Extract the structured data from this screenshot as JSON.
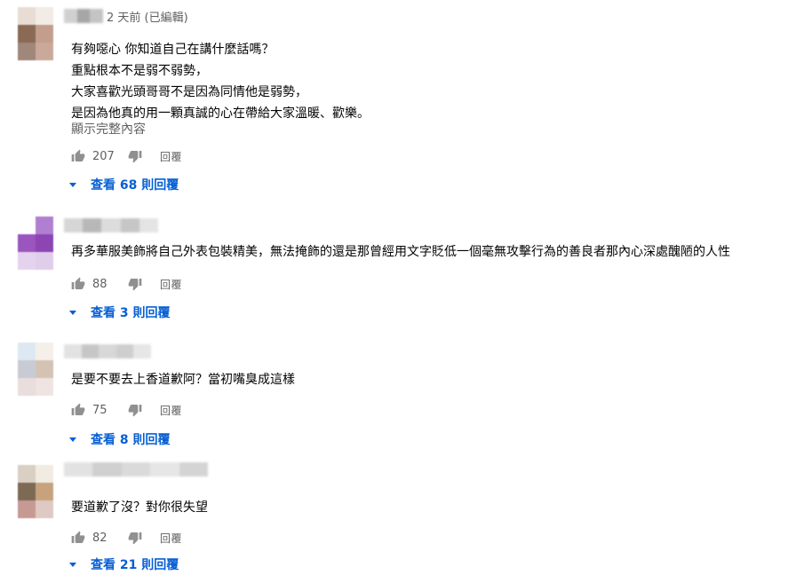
{
  "comments": [
    {
      "timestamp": "2 天前 (已編輯)",
      "lines": [
        "有夠噁心 你知道自己在講什麼話嗎？",
        "重點根本不是弱不弱勢，",
        "大家喜歡光頭哥哥不是因為同情他是弱勢，",
        "是因為他真的用一顆真誠的心在帶給大家溫暖、歡樂。"
      ],
      "show_more": "顯示完整內容",
      "likes": "207",
      "reply": "回覆",
      "view_replies": "查看 68 則回覆",
      "avatar_colors": [
        "#e8dcd5",
        "#f2ebe6",
        "#8a6a55",
        "#c49e8d",
        "#9f8779",
        "#caa89a"
      ],
      "name_colors": [
        "#d0d0d0",
        "#a6a6a6",
        "#c4c4c4"
      ]
    },
    {
      "timestamp": "",
      "lines": [
        "再多華服美飾將自己外表包裝精美，無法掩飾的還是那曾經用文字貶低一個毫無攻擊行為的善良者那內心深處醜陋的人性"
      ],
      "show_more": "",
      "likes": "88",
      "reply": "回覆",
      "view_replies": "查看 3 則回覆",
      "avatar_colors": [
        "#ffffff",
        "#b17fd1",
        "#9a55be",
        "#8c45b3",
        "#e4d2ee",
        "#e0cdea"
      ],
      "name_colors": [
        "#d6d6d6",
        "#b8b8b8",
        "#dcdcdc",
        "#c6c6c6",
        "#e4e4e4"
      ]
    },
    {
      "timestamp": "",
      "lines": [
        "是要不要去上香道歉阿？當初嘴臭成這樣"
      ],
      "show_more": "",
      "likes": "75",
      "reply": "回覆",
      "view_replies": "查看 8 則回覆",
      "avatar_colors": [
        "#dde8f2",
        "#f4efe9",
        "#c8cbd3",
        "#d4c2b5",
        "#e9dddd",
        "#efe4e2"
      ],
      "name_colors": [
        "#e2e2e2",
        "#c6c6c6",
        "#d8d8d8",
        "#cecece",
        "#e6e6e6"
      ]
    },
    {
      "timestamp": "",
      "lines": [
        "要道歉了沒？對你很失望"
      ],
      "show_more": "",
      "likes": "82",
      "reply": "回覆",
      "view_replies": "查看 21 則回覆",
      "avatar_colors": [
        "#d9d0c3",
        "#f1ebe2",
        "#7d6a55",
        "#c7a27d",
        "#c79993",
        "#e0c9c3"
      ],
      "name_colors": [
        "#e2e2e2",
        "#cfcfcf",
        "#dadada",
        "#e6e6e6",
        "#d4d4d4"
      ]
    }
  ]
}
